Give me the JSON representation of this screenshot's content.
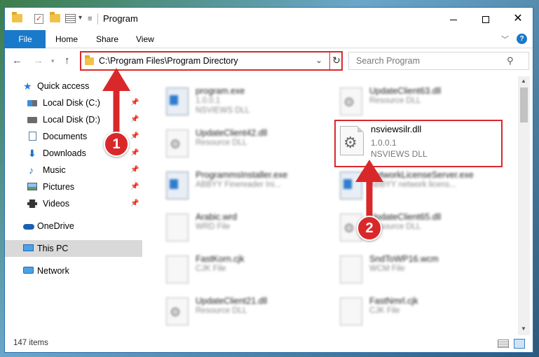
{
  "window": {
    "title": "Program",
    "quick_access_dropdown": "▾"
  },
  "ribbon": {
    "tabs": [
      "File",
      "Home",
      "Share",
      "View"
    ],
    "help": "?"
  },
  "nav": {
    "address": "C:\\Program Files\\Program Directory",
    "search_placeholder": "Search Program"
  },
  "sidebar": {
    "items": [
      {
        "label": "Quick access",
        "icon": "star-icon"
      },
      {
        "label": "Local Disk (C:)",
        "icon": "drive-icon",
        "pinned": true
      },
      {
        "label": "Local Disk (D:)",
        "icon": "drive-icon",
        "pinned": true
      },
      {
        "label": "Documents",
        "icon": "documents-icon",
        "pinned": true
      },
      {
        "label": "Downloads",
        "icon": "downloads-icon",
        "pinned": true
      },
      {
        "label": "Music",
        "icon": "music-icon",
        "pinned": true
      },
      {
        "label": "Pictures",
        "icon": "pictures-icon",
        "pinned": true
      },
      {
        "label": "Videos",
        "icon": "videos-icon",
        "pinned": true
      },
      {
        "label": "OneDrive",
        "icon": "onedrive-icon"
      },
      {
        "label": "This PC",
        "icon": "computer-icon",
        "selected": true
      },
      {
        "label": "Network",
        "icon": "network-icon"
      }
    ]
  },
  "files": [
    {
      "name": "program.exe",
      "line1": "1.0.0.1",
      "line2": "NSVIEWS DLL",
      "kind": "exe"
    },
    {
      "name": "UpdateClient63.dll",
      "line1": "Resource DLL",
      "line2": "",
      "kind": "dll"
    },
    {
      "name": "UpdateClient42.dll",
      "line1": "Resource DLL",
      "line2": "",
      "kind": "dll"
    },
    {
      "name": "ProgrammsInstaller.exe",
      "line1": "ABBYY Finereader Ini...",
      "line2": "",
      "kind": "exe"
    },
    {
      "name": "NetworkLicenseServer.exe",
      "line1": "ABBYY network licens...",
      "line2": "",
      "kind": "exe"
    },
    {
      "name": "Arabic.wrd",
      "line1": "WRD File",
      "line2": "",
      "kind": "blank"
    },
    {
      "name": "UpdateClient65.dll",
      "line1": "Resource DLL",
      "line2": "",
      "kind": "dll"
    },
    {
      "name": "FastKorn.cjk",
      "line1": "CJK File",
      "line2": "",
      "kind": "blank"
    },
    {
      "name": "SndToWP16.wcm",
      "line1": "WCM File",
      "line2": "",
      "kind": "blank"
    },
    {
      "name": "UpdateClient21.dll",
      "line1": "Resource DLL",
      "line2": "",
      "kind": "dll"
    },
    {
      "name": "FastNmrl.cjk",
      "line1": "CJK File",
      "line2": "",
      "kind": "blank"
    }
  ],
  "highlighted_file": {
    "name": "nsviewsilr.dll",
    "version": "1.0.0.1",
    "description": "NSVIEWS DLL"
  },
  "callouts": {
    "step1": "1",
    "step2": "2",
    "color": "#d9282a"
  },
  "status": {
    "item_count": "147 items"
  }
}
